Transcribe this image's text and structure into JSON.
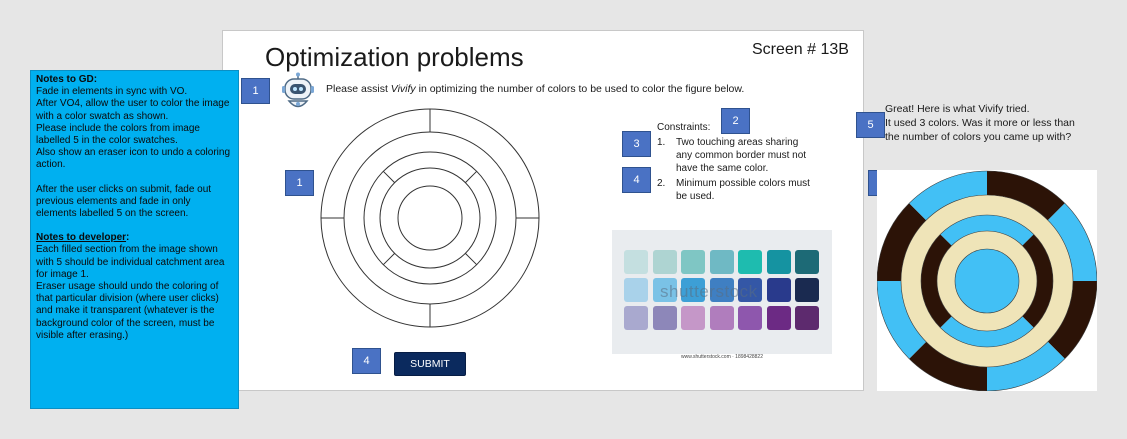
{
  "slide": {
    "title": "Optimization problems",
    "screen_id": "Screen # 13B",
    "prompt_before": "Please assist ",
    "prompt_name": "Vivify",
    "prompt_after": " in optimizing the number of colors to be used to color the figure below.",
    "constraints": {
      "heading": "Constraints:",
      "items": [
        {
          "num": "1.",
          "text": "Two touching areas sharing any common border must not have the same color."
        },
        {
          "num": "2.",
          "text": "Minimum possible colors must be used."
        }
      ]
    },
    "submit_label": "SUBMIT",
    "swatch_watermark": "shutterstock",
    "swatch_url": "www.shutterstock.com · 1898428822",
    "swatch_colors": [
      [
        "#c4dfe0",
        "#aed4d2",
        "#7fc6c4",
        "#6fb9c4",
        "#1ebcaf",
        "#1593a1",
        "#1d6a76"
      ],
      [
        "#a9d2ea",
        "#7ac2e6",
        "#3d9fd6",
        "#3f7fc2",
        "#3457a6",
        "#293a8c",
        "#1a2a50"
      ],
      [
        "#a9a9cf",
        "#8d87b9",
        "#c597c8",
        "#b07dbd",
        "#8e57ad",
        "#6c2a84",
        "#5d2a6e"
      ]
    ]
  },
  "tags": {
    "t1_header": "1",
    "t1_figure": "1",
    "t2": "2",
    "t3": "3",
    "t4_constraints": "4",
    "t4_submit": "4",
    "t5_text": "5",
    "t5_image": "5"
  },
  "notes": {
    "gd_heading": "Notes to GD:",
    "gd_lines": [
      "Fade in elements in sync with VO.",
      "After VO4,  allow the user to color the image with a color swatch as shown.",
      "Please include the colors  from image labelled 5 in the color swatches.",
      "Also show an eraser icon to undo a coloring action."
    ],
    "gd_after_submit": "After the user clicks on submit, fade out previous elements and fade in only elements labelled 5 on the screen.",
    "dev_heading": "Notes to developer",
    "dev_heading_suffix": ":",
    "dev_lines": [
      "Each filled section from the image shown with 5 should be  individual catchment area for image 1.",
      "Eraser usage should undo the coloring of that particular division (where user clicks) and make it transparent (whatever is the background color of the screen, must be visible after erasing.)"
    ]
  },
  "result": {
    "lines": [
      "Great! Here is what Vivify tried.",
      "It used 3 colors. Was it more or less than",
      "the number of colors you came up with?"
    ],
    "colors": {
      "blue": "#42c0f5",
      "brown": "#2c1307",
      "cream": "#efe4b8"
    }
  },
  "icons": {
    "robot": "robot-mascot-icon"
  }
}
